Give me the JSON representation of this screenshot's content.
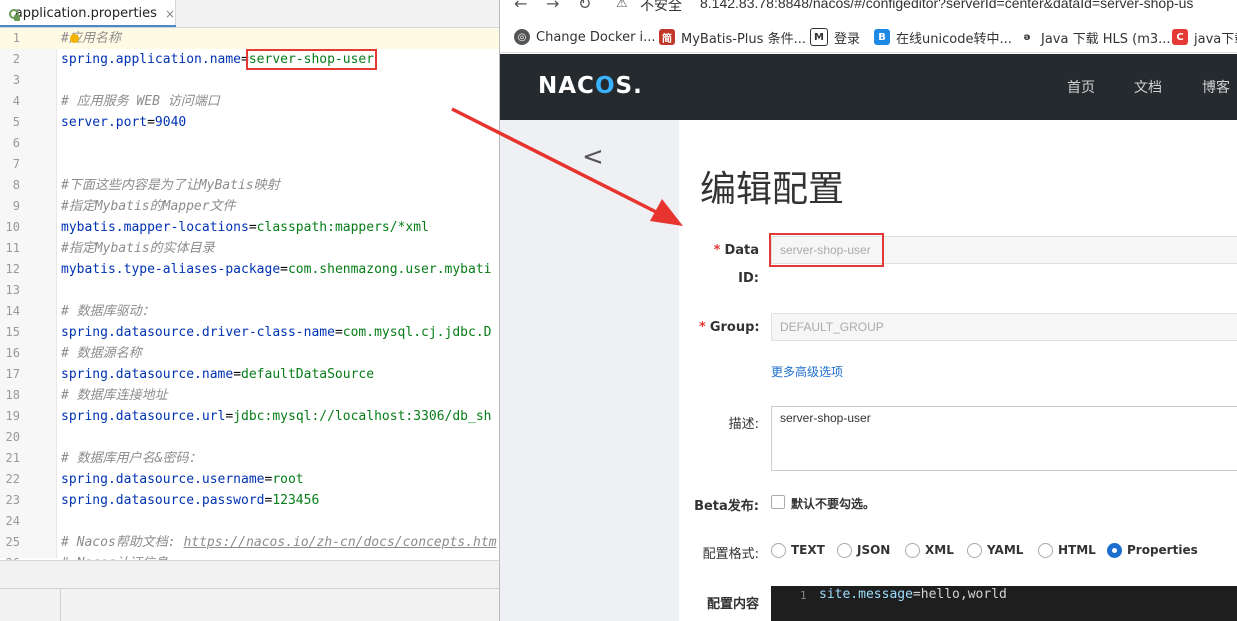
{
  "ide": {
    "tab_label": "application.properties",
    "tab_close": "×",
    "lines": [
      {
        "n": "1",
        "parts": [
          {
            "t": "#应用名称",
            "c": "cmt"
          }
        ]
      },
      {
        "n": "2",
        "parts": [
          {
            "t": "spring.application.name",
            "c": "key"
          },
          {
            "t": "=",
            "c": "eq"
          },
          {
            "t": "server-shop-user",
            "c": "val",
            "box": true
          }
        ]
      },
      {
        "n": "3",
        "parts": []
      },
      {
        "n": "4",
        "parts": [
          {
            "t": "# 应用服务 WEB 访问端口",
            "c": "cmt"
          }
        ]
      },
      {
        "n": "5",
        "parts": [
          {
            "t": "server.port",
            "c": "key"
          },
          {
            "t": "=",
            "c": "eq"
          },
          {
            "t": "9040",
            "c": "key"
          }
        ]
      },
      {
        "n": "6",
        "parts": []
      },
      {
        "n": "7",
        "parts": []
      },
      {
        "n": "8",
        "parts": [
          {
            "t": "#下面这些内容是为了让MyBatis映射",
            "c": "cmt"
          }
        ]
      },
      {
        "n": "9",
        "parts": [
          {
            "t": "#指定Mybatis的Mapper文件",
            "c": "cmt"
          }
        ]
      },
      {
        "n": "10",
        "parts": [
          {
            "t": "mybatis.mapper-locations",
            "c": "key"
          },
          {
            "t": "=",
            "c": "eq"
          },
          {
            "t": "classpath:mappers/*xml",
            "c": "val"
          }
        ]
      },
      {
        "n": "11",
        "parts": [
          {
            "t": "#指定Mybatis的实体目录",
            "c": "cmt"
          }
        ]
      },
      {
        "n": "12",
        "parts": [
          {
            "t": "mybatis.type-aliases-package",
            "c": "key"
          },
          {
            "t": "=",
            "c": "eq"
          },
          {
            "t": "com.shenmazong.user.mybati",
            "c": "val"
          }
        ]
      },
      {
        "n": "13",
        "parts": []
      },
      {
        "n": "14",
        "parts": [
          {
            "t": "# 数据库驱动：",
            "c": "cmt"
          }
        ]
      },
      {
        "n": "15",
        "parts": [
          {
            "t": "spring.datasource.driver-class-name",
            "c": "key"
          },
          {
            "t": "=",
            "c": "eq"
          },
          {
            "t": "com.mysql.cj.jdbc.D",
            "c": "val"
          }
        ]
      },
      {
        "n": "16",
        "parts": [
          {
            "t": "# 数据源名称",
            "c": "cmt"
          }
        ]
      },
      {
        "n": "17",
        "parts": [
          {
            "t": "spring.datasource.name",
            "c": "key"
          },
          {
            "t": "=",
            "c": "eq"
          },
          {
            "t": "defaultDataSource",
            "c": "val"
          }
        ]
      },
      {
        "n": "18",
        "parts": [
          {
            "t": "# 数据库连接地址",
            "c": "cmt"
          }
        ]
      },
      {
        "n": "19",
        "parts": [
          {
            "t": "spring.datasource.url",
            "c": "key"
          },
          {
            "t": "=",
            "c": "eq"
          },
          {
            "t": "jdbc:mysql://localhost:3306/db_sh",
            "c": "val"
          }
        ]
      },
      {
        "n": "20",
        "parts": []
      },
      {
        "n": "21",
        "parts": [
          {
            "t": "# 数据库用户名&密码：",
            "c": "cmt"
          }
        ]
      },
      {
        "n": "22",
        "parts": [
          {
            "t": "spring.datasource.username",
            "c": "key"
          },
          {
            "t": "=",
            "c": "eq"
          },
          {
            "t": "root",
            "c": "val"
          }
        ]
      },
      {
        "n": "23",
        "parts": [
          {
            "t": "spring.datasource.password",
            "c": "key"
          },
          {
            "t": "=",
            "c": "eq"
          },
          {
            "t": "123456",
            "c": "val"
          }
        ]
      },
      {
        "n": "24",
        "parts": []
      },
      {
        "n": "25",
        "parts": [
          {
            "t": "# Nacos帮助文档: ",
            "c": "cmt"
          },
          {
            "t": "https://nacos.io/zh-cn/docs/concepts.htm",
            "c": "cmt url"
          }
        ]
      },
      {
        "n": "26",
        "parts": [
          {
            "t": "# Nacos认证信息",
            "c": "cmt"
          }
        ]
      }
    ]
  },
  "browser": {
    "nav_back": "←",
    "nav_forward": "→",
    "nav_reload": "↻",
    "security_label": "不安全",
    "address": "8.142.83.78:8848/nacos/#/configeditor?serverId=center&dataId=server-shop-us",
    "bookmarks": [
      {
        "label": "Change Docker i...",
        "icon": "globe",
        "color": "#555"
      },
      {
        "label": "MyBatis-Plus 条件...",
        "icon": "简",
        "color": "#c0392b"
      },
      {
        "label": "登录",
        "icon": "M",
        "color": "#333"
      },
      {
        "label": "在线unicode转中...",
        "icon": "B",
        "color": "#1e88e5"
      },
      {
        "label": "Java 下载 HLS (m3...",
        "icon": "ə",
        "color": "#333"
      },
      {
        "label": "java下载",
        "icon": "C",
        "color": "#e53935"
      }
    ]
  },
  "nacos": {
    "logo_prefix": "NAC",
    "logo_o": "O",
    "logo_suffix": "S.",
    "nav": [
      "首页",
      "文档",
      "博客"
    ],
    "collapse_icon": "<",
    "page_title": "编辑配置",
    "form": {
      "data_id_label_1": "Data",
      "data_id_label_2": "ID:",
      "data_id_value": "server-shop-user",
      "group_label": "Group:",
      "group_value": "DEFAULT_GROUP",
      "advanced_link": "更多高级选项",
      "desc_label": "描述:",
      "desc_value": "server-shop-user",
      "beta_label": "Beta发布:",
      "beta_check_label": "默认不要勾选。",
      "format_label": "配置格式:",
      "formats": [
        "TEXT",
        "JSON",
        "XML",
        "YAML",
        "HTML",
        "Properties"
      ],
      "format_selected": "Properties",
      "content_label": "配置内容",
      "editor_line_no": "1",
      "editor_key": "site.message",
      "editor_rest": "=hello,world"
    }
  }
}
